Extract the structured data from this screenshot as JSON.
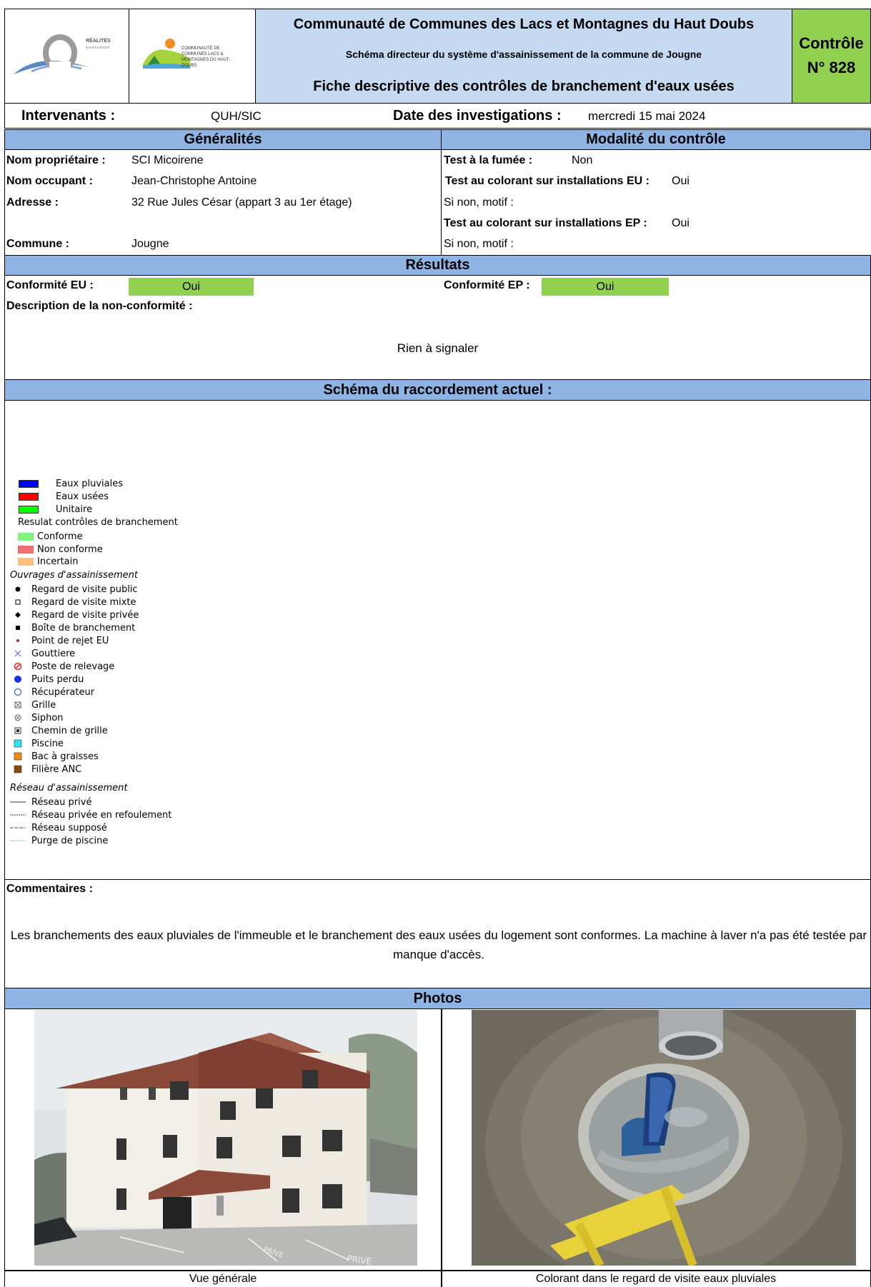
{
  "header": {
    "logo_realites_text": "RÉALITÉS",
    "logo_realites_sub": "Environnement",
    "logo_cc_text": "COMMUNAUTÉ DE COMMUNES LACS & MONTAGNES DU HAUT-DOUBS",
    "title": "Communauté de Communes des Lacs et Montagnes du Haut Doubs",
    "subtitle": "Schéma directeur du système d'assainissement de la commune de Jougne",
    "heading": "Fiche descriptive des contrôles de branchement d'eaux usées",
    "control_label": "Contrôle",
    "control_number": "N° 828"
  },
  "info": {
    "intervenants_label": "Intervenants :",
    "intervenants_value": "QUH/SIC",
    "date_label": "Date des investigations :",
    "date_value": "mercredi 15 mai 2024"
  },
  "generalites": {
    "title": "Généralités",
    "proprietaire_label": "Nom propriétaire :",
    "proprietaire_value": "SCI Micoirene",
    "occupant_label": "Nom occupant :",
    "occupant_value": "Jean-Christophe Antoine",
    "adresse_label": "Adresse :",
    "adresse_value": "32 Rue Jules César (appart 3 au 1er étage)",
    "commune_label": "Commune :",
    "commune_value": "Jougne"
  },
  "modalite": {
    "title": "Modalité du contrôle",
    "fumee_label": "Test à la fumée :",
    "fumee_value": "Non",
    "colorant_eu_label": "Test au colorant sur installations EU :",
    "colorant_eu_value": "Oui",
    "motif_eu_label": "Si non, motif :",
    "colorant_ep_label": "Test au colorant sur installations EP :",
    "colorant_ep_value": "Oui",
    "motif_ep_label": "Si non, motif :"
  },
  "resultats": {
    "title": "Résultats",
    "conformite_eu_label": "Conformité EU :",
    "conformite_eu_value": "Oui",
    "conformite_ep_label": "Conformité EP :",
    "conformite_ep_value": "Oui",
    "description_label": "Description de la non-conformité :",
    "description_value": "Rien à signaler"
  },
  "schema": {
    "title": "Schéma du raccordement actuel :",
    "legend": {
      "eaux_pluviales": "Eaux pluviales",
      "eaux_usees": "Eaux usées",
      "unitaire": "Unitaire",
      "resultat_title": "Resulat contrôles de branchement",
      "conforme": "Conforme",
      "non_conforme": "Non conforme",
      "incertain": "Incertain",
      "ouvrages_title": "Ouvrages d'assainissement",
      "regard_public": "Regard de visite public",
      "regard_mixte": "Regard de visite mixte",
      "regard_privee": "Regard de visite privée",
      "boite": "Boîte de branchement",
      "point_rejet": "Point de rejet EU",
      "gouttiere": "Gouttiere",
      "poste_relevage": "Poste de relevage",
      "puits_perdu": "Puits perdu",
      "recuperateur": "Récupérateur",
      "grille": "Grille",
      "siphon": "Siphon",
      "chemin_grille": "Chemin de grille",
      "piscine": "Piscine",
      "bac_graisses": "Bac à graisses",
      "filiere_anc": "Filière ANC",
      "reseau_title": "Réseau d'assainissement",
      "reseau_prive": "Réseau privé",
      "reseau_refoulement": "Réseau privée en refoulement",
      "reseau_suppose": "Réseau supposé",
      "purge_piscine": "Purge de piscine"
    },
    "colors": {
      "eaux_pluviales": "#0000ff",
      "eaux_usees": "#ff0000",
      "unitaire": "#00ff00",
      "conforme": "#7ff27f",
      "non_conforme": "#f07070",
      "incertain": "#ffc080"
    }
  },
  "commentaires": {
    "label": "Commentaires :",
    "text": "Les branchements des eaux pluviales de l'immeuble et le branchement des eaux usées du logement sont conformes. La machine à laver n'a pas été testée par manque d'accès."
  },
  "photos": {
    "title": "Photos",
    "wall_text": "PRIVE",
    "ground_text": "PRIVÉ",
    "caption_left": "Vue générale",
    "caption_right": "Colorant dans le regard de visite eaux pluviales"
  },
  "theme": {
    "header_blue": "#c5d9f1",
    "band_blue": "#8db4e2",
    "green": "#92d050"
  }
}
